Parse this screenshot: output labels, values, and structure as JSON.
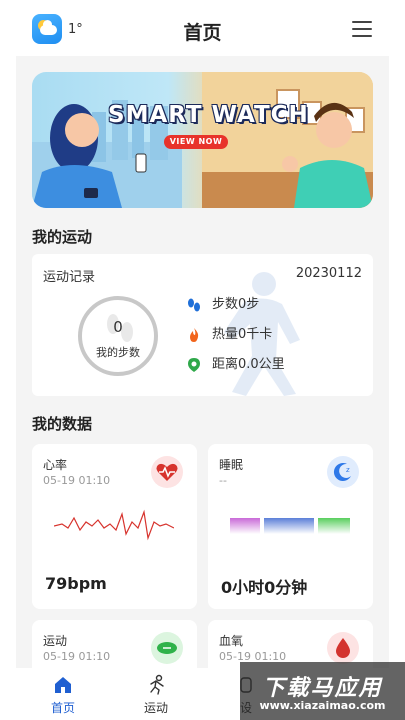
{
  "header": {
    "temperature": "1°",
    "title": "首页",
    "weather_icon": "partly-cloudy-icon",
    "menu_icon": "hamburger-menu-icon"
  },
  "banner": {
    "headline": "SMART WATCH",
    "cta": "VIEW NOW"
  },
  "sections": {
    "my_sport": "我的运动",
    "my_data": "我的数据"
  },
  "record": {
    "label": "运动记录",
    "date": "20230112",
    "steps_value": "0",
    "steps_caption": "我的步数",
    "stats": [
      {
        "text": "步数0步",
        "icon": "footprints-icon",
        "color": "#1f6fd8"
      },
      {
        "text": "热量0千卡",
        "icon": "flame-icon",
        "color": "#f2641b"
      },
      {
        "text": "距离0.0公里",
        "icon": "location-pin-icon",
        "color": "#2fa84a"
      }
    ]
  },
  "cards": [
    {
      "name": "心率",
      "time": "05-19 01:10",
      "value": "79bpm",
      "icon": "heart-rate-icon"
    },
    {
      "name": "睡眠",
      "time": "--",
      "value": "0小时0分钟",
      "icon": "moon-sleep-icon"
    },
    {
      "name": "运动",
      "time": "05-19 01:10",
      "value": "",
      "icon": "sport-ball-icon"
    },
    {
      "name": "血氧",
      "time": "05-19 01:10",
      "value": "",
      "icon": "blood-drop-icon"
    }
  ],
  "nav": [
    {
      "label": "首页",
      "icon": "home-icon",
      "active": true
    },
    {
      "label": "运动",
      "icon": "running-icon",
      "active": false
    },
    {
      "label": "设",
      "icon": "device-icon",
      "active": false
    }
  ],
  "watermark": {
    "main": "下载马应用",
    "sub": "www.xiazaimao.com"
  },
  "colors": {
    "accent": "#1f5fd1",
    "background": "#f4f4f4",
    "heart": "#d7332d",
    "sleep": "#2f79e8",
    "sport": "#2fb24a",
    "oxygen": "#d3332e"
  }
}
